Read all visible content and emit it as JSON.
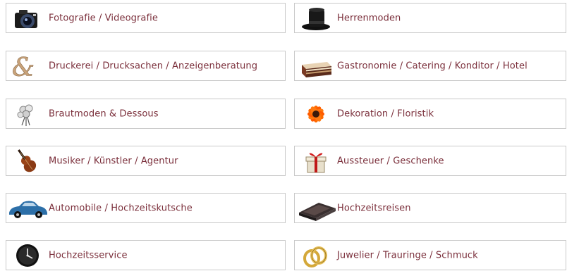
{
  "categories": {
    "left": [
      {
        "label": "Fotografie / Videografie",
        "icon": "camera-icon"
      },
      {
        "label": "Druckerei / Drucksachen / Anzeigenberatung",
        "icon": "ampersand-icon"
      },
      {
        "label": "Brautmoden & Dessous",
        "icon": "bridal-bouquet-icon"
      },
      {
        "label": "Musiker / Künstler / Agentur",
        "icon": "violin-icon"
      },
      {
        "label": "Automobile / Hochzeitskutsche",
        "icon": "classic-car-icon"
      },
      {
        "label": "Hochzeitsservice",
        "icon": "clock-icon"
      }
    ],
    "right": [
      {
        "label": "Herrenmoden",
        "icon": "top-hat-icon"
      },
      {
        "label": "Gastronomie / Catering / Konditor / Hotel",
        "icon": "cake-slice-icon"
      },
      {
        "label": "Dekoration / Floristik",
        "icon": "flower-icon"
      },
      {
        "label": "Aussteuer / Geschenke",
        "icon": "gift-box-icon"
      },
      {
        "label": "Hochzeitsreisen",
        "icon": "travel-book-icon"
      },
      {
        "label": "Juwelier / Trauringe / Schmuck",
        "icon": "wedding-rings-icon"
      }
    ]
  },
  "colors": {
    "label_text": "#7a2e3a",
    "border": "#c9c9c9"
  }
}
